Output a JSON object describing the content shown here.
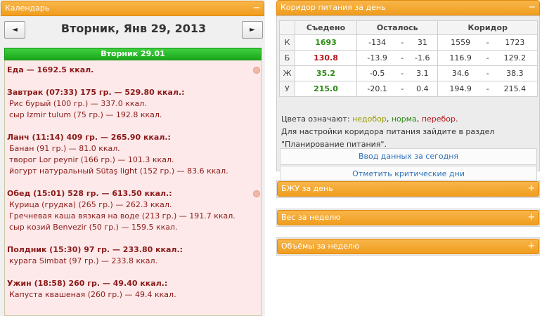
{
  "calendar": {
    "header": "Календарь",
    "collapse_icon": "−",
    "prev_label": "◄",
    "next_label": "►",
    "date_title": "Вторник, Янв 29, 2013",
    "day_label": "Вторник 29.01",
    "food_total": "Еда — 1692.5 ккал.",
    "meals": [
      {
        "title": "Завтрак (07:33) 175 гр. — 529.80 ккал.:",
        "items": [
          "Рис бурый (100 гр.) — 337.0 ккал.",
          "сыр Izmir tulum (75 гр.) — 192.8 ккал."
        ]
      },
      {
        "title": "Ланч (11:14) 409 гр. — 265.90 ккал.:",
        "items": [
          "Банан (91 гр.) — 81.0 ккал.",
          "творог Lor peynir (166 гр.) — 101.3 ккал.",
          "йогурт натуральный Sütaş light (152 гр.) — 83.6 ккал."
        ]
      },
      {
        "title": "Обед (15:01) 528 гр. — 613.50 ккал.:",
        "items": [
          "Курица (грудка) (265 гр.) — 262.3 ккал.",
          "Гречневая каша вязкая на воде (213 гр.) — 191.7 ккал.",
          "сыр козий Benvezir (50 гр.) — 159.5 ккал."
        ]
      },
      {
        "title": "Полдник (15:30) 97 гр. — 233.80 ккал.:",
        "items": [
          "курага Simbat (97 гр.) — 233.8 ккал."
        ]
      },
      {
        "title": "Ужин (18:58) 260 гр. — 49.40 ккал.:",
        "items": [
          "Капуста квашеная (260 гр.) — 49.4 ккал."
        ]
      }
    ]
  },
  "corridor": {
    "header": "Коридор питания за день",
    "collapse_icon": "−",
    "columns": [
      "Съедено",
      "Осталось",
      "Коридор"
    ],
    "rows": [
      {
        "label": "К",
        "eaten": "1693",
        "eaten_color": "green",
        "left_min": "-134",
        "dash1": "-",
        "left_max": "31",
        "corr_min": "1559",
        "dash2": "-",
        "corr_max": "1723"
      },
      {
        "label": "Б",
        "eaten": "130.8",
        "eaten_color": "red",
        "left_min": "-13.9",
        "dash1": "-",
        "left_max": "-1.6",
        "corr_min": "116.9",
        "dash2": "-",
        "corr_max": "129.2"
      },
      {
        "label": "Ж",
        "eaten": "35.2",
        "eaten_color": "green",
        "left_min": "-0.5",
        "dash1": "-",
        "left_max": "3.1",
        "corr_min": "34.6",
        "dash2": "-",
        "corr_max": "38.3"
      },
      {
        "label": "У",
        "eaten": "215.0",
        "eaten_color": "green",
        "left_min": "-20.1",
        "dash1": "-",
        "left_max": "0.4",
        "corr_min": "194.9",
        "dash2": "-",
        "corr_max": "215.4"
      }
    ],
    "legend_prefix": "Цвета означают:",
    "legend_under": "недобор",
    "legend_sep1": ",",
    "legend_norm": "норма",
    "legend_sep2": ",",
    "legend_over": "перебор",
    "legend_end": ".",
    "hint_line1": "Для настройки коридора питания зайдите в раздел",
    "hint_line2": "\"Планирование питания\".",
    "btn_today": "Ввод данных за сегодня",
    "btn_critical": "Отметить критические дни"
  },
  "panels": {
    "bju": "БЖУ за день",
    "weight": "Вес за неделю",
    "volume": "Объёмы за неделю",
    "expand_icon": "+"
  },
  "colors": {
    "accent": "#f09d1e",
    "green": "#2a8a12",
    "red": "#b3171b",
    "olive": "#999900",
    "link": "#2a70b8"
  }
}
